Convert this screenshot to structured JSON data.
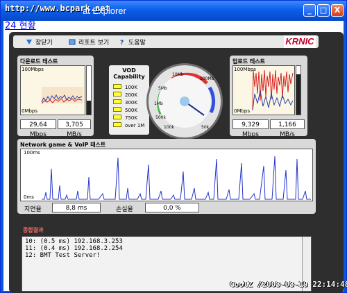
{
  "window": {
    "watermark": "http://www.bcpark.net",
    "title": "at Explorer",
    "controls": {
      "minimize": "_",
      "maximize": "□",
      "close": "X"
    }
  },
  "page": {
    "link": "24 현황"
  },
  "toolbar": {
    "items": [
      {
        "label": "창닫기",
        "icon": "close-window-icon"
      },
      {
        "label": "리포트 보기",
        "icon": "report-icon"
      },
      {
        "label": "도움말",
        "icon": "help-icon"
      }
    ],
    "logo": "KRNIC"
  },
  "download": {
    "title": "다운로드 테스트",
    "max_label": "100Mbps",
    "min_label": "0Mbps",
    "mbps": "29,64 Mbps",
    "mbs": "3,705 MB/s"
  },
  "upload": {
    "title": "업로드 테스트",
    "max_label": "100Mbps",
    "min_label": "0Mbps",
    "mbps": "9,329 Mbps",
    "mbs": "1,166 MB/s"
  },
  "vod": {
    "title": "VOD Capability",
    "items": [
      "100K",
      "200K",
      "300K",
      "500K",
      "750K",
      "over 1M"
    ]
  },
  "gauge": {
    "scale_labels": [
      "10Mb",
      "5Mb",
      "1Mb",
      "500k",
      "100k",
      "50k",
      "100Mb"
    ]
  },
  "network": {
    "title": "Network game & VoIP 테스트",
    "max_label": "100ms",
    "min_label": "0ms",
    "latency_label": "지연율",
    "latency": "8,8 ms",
    "loss_label": "손실율",
    "loss": "0,0 %"
  },
  "summary": {
    "title": "종합결과",
    "lines": [
      "10: (0.5 ms) 192.168.3.253",
      "11: (0.4 ms) 192.168.2.254",
      "12: BMT Test Server!"
    ]
  },
  "stamp": "CoolZ /2003-03-19 22:14:48",
  "colors": {
    "window_blue": "#0a58d8",
    "panel_dark": "#2e2e2e",
    "download_line": "#2a3fa8",
    "upload_line": "#d42020",
    "network_line": "#2233cc",
    "logo_red": "#c0002b"
  }
}
